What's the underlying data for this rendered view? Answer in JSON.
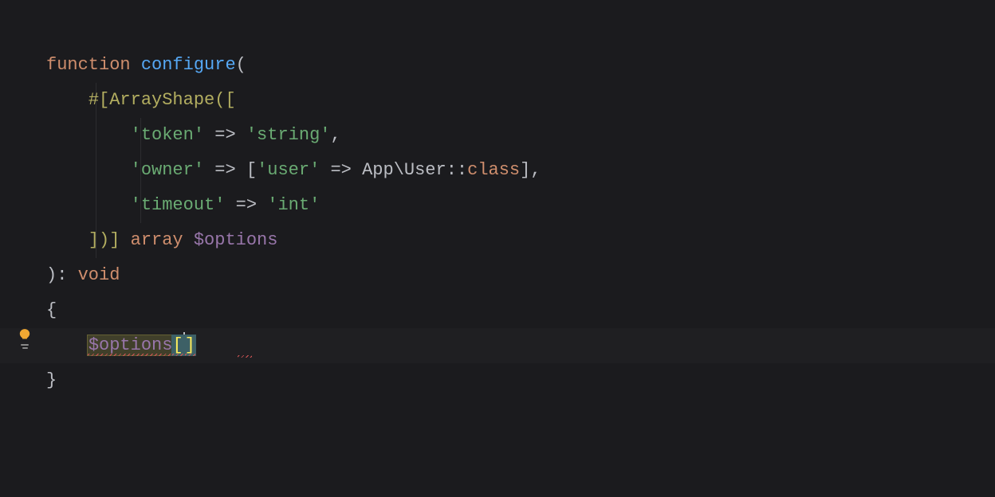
{
  "code": {
    "line1": {
      "kw": "function",
      "space": " ",
      "fn": "configure",
      "tail": "("
    },
    "line2": {
      "indent": "    ",
      "hash": "#[",
      "attr": "ArrayShape",
      "tail": "(["
    },
    "line3": {
      "indent": "        ",
      "key": "'token'",
      "arrow": " => ",
      "val": "'string'",
      "comma": ","
    },
    "line4": {
      "indent": "        ",
      "key": "'owner'",
      "arrow": " => [",
      "inner_key": "'user'",
      "inner_arrow": " => ",
      "ns": "App\\User::",
      "class": "class",
      "close": "],"
    },
    "line5": {
      "indent": "        ",
      "key": "'timeout'",
      "arrow": " => ",
      "val": "'int'"
    },
    "line6": {
      "indent": "    ",
      "close": "])] ",
      "type": "array",
      "space": " ",
      "var": "$options"
    },
    "line7": {
      "close": "): ",
      "void": "void"
    },
    "line8": {
      "brace": "{"
    },
    "line9": {
      "indent": "    ",
      "var": "$options",
      "open": "[",
      "close_sq": "]"
    },
    "line10": {
      "brace": "}"
    }
  },
  "icons": {
    "lightbulb": "lightbulb"
  }
}
